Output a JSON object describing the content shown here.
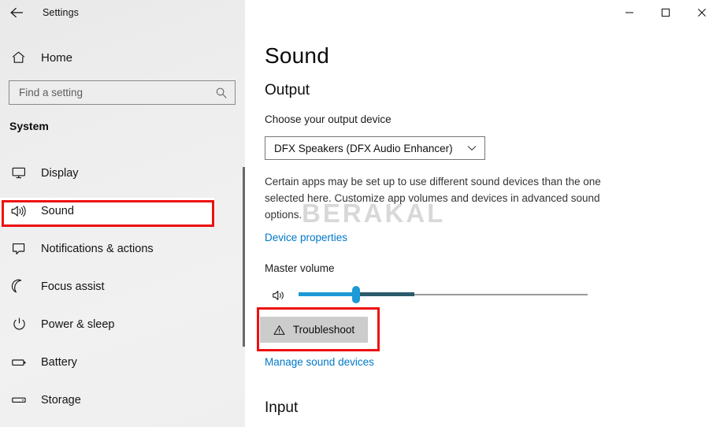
{
  "titlebar": {
    "back_icon": "back-arrow-icon",
    "title": "Settings",
    "minimize_label": "Minimize",
    "maximize_label": "Maximize",
    "close_label": "Close"
  },
  "sidebar": {
    "home": {
      "label": "Home",
      "icon": "home-icon"
    },
    "search": {
      "placeholder": "Find a setting",
      "value": "",
      "icon": "search-icon"
    },
    "group_title": "System",
    "items": [
      {
        "label": "Display",
        "icon": "monitor-icon",
        "selected": false
      },
      {
        "label": "Sound",
        "icon": "speaker-icon",
        "selected": true
      },
      {
        "label": "Notifications & actions",
        "icon": "notification-icon",
        "selected": false
      },
      {
        "label": "Focus assist",
        "icon": "moon-icon",
        "selected": false
      },
      {
        "label": "Power & sleep",
        "icon": "power-icon",
        "selected": false
      },
      {
        "label": "Battery",
        "icon": "battery-icon",
        "selected": false
      },
      {
        "label": "Storage",
        "icon": "storage-icon",
        "selected": false
      }
    ]
  },
  "main": {
    "page_title": "Sound",
    "output": {
      "section_title": "Output",
      "device_label": "Choose your output device",
      "device_value": "DFX Speakers (DFX Audio Enhancer)",
      "description": "Certain apps may be set up to use different sound devices than the one selected here. Customize app volumes and devices in advanced sound options.",
      "device_properties_link": "Device properties",
      "volume_label": "Master volume",
      "volume_value": "20",
      "volume_percent": 20,
      "troubleshoot_label": "Troubleshoot",
      "manage_devices_link": "Manage sound devices"
    },
    "input": {
      "section_title": "Input"
    }
  },
  "watermark": {
    "text": "BERAKAL"
  },
  "annotations": {
    "highlight_color": "#ee1111",
    "boxes": [
      "sidebar-item-sound",
      "troubleshoot-button"
    ]
  },
  "colors": {
    "accent_link": "#0078c8",
    "slider_bright": "#1c9ad6",
    "slider_dark": "#2c5b6b",
    "sidebar_bg": "#eeeeee"
  }
}
